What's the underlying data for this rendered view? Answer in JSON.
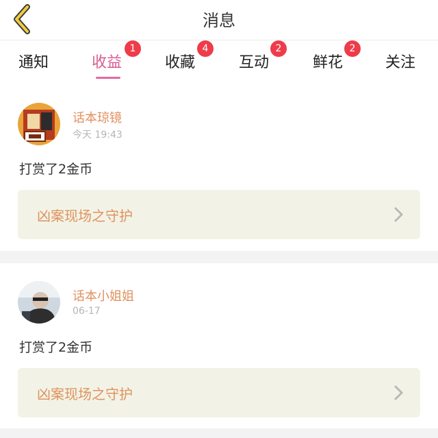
{
  "header": {
    "title": "消息"
  },
  "tabs": [
    {
      "label": "通知",
      "badge": ""
    },
    {
      "label": "收益",
      "badge": "1"
    },
    {
      "label": "收藏",
      "badge": "4"
    },
    {
      "label": "互动",
      "badge": "2"
    },
    {
      "label": "鲜花",
      "badge": "2"
    },
    {
      "label": "关注",
      "badge": ""
    }
  ],
  "messages": [
    {
      "user": "话本琼镜",
      "time": "今天 19:43",
      "text": "打赏了2金币",
      "work": "凶案现场之守护"
    },
    {
      "user": "话本小姐姐",
      "time": "06-17",
      "text": "打赏了2金币",
      "work": "凶案现场之守护"
    }
  ],
  "colors": {
    "accent_pink": "#d85c93",
    "badge_red": "#ee3c4a",
    "name_orange": "#e0915e",
    "card_bg": "#f2f3e6"
  }
}
